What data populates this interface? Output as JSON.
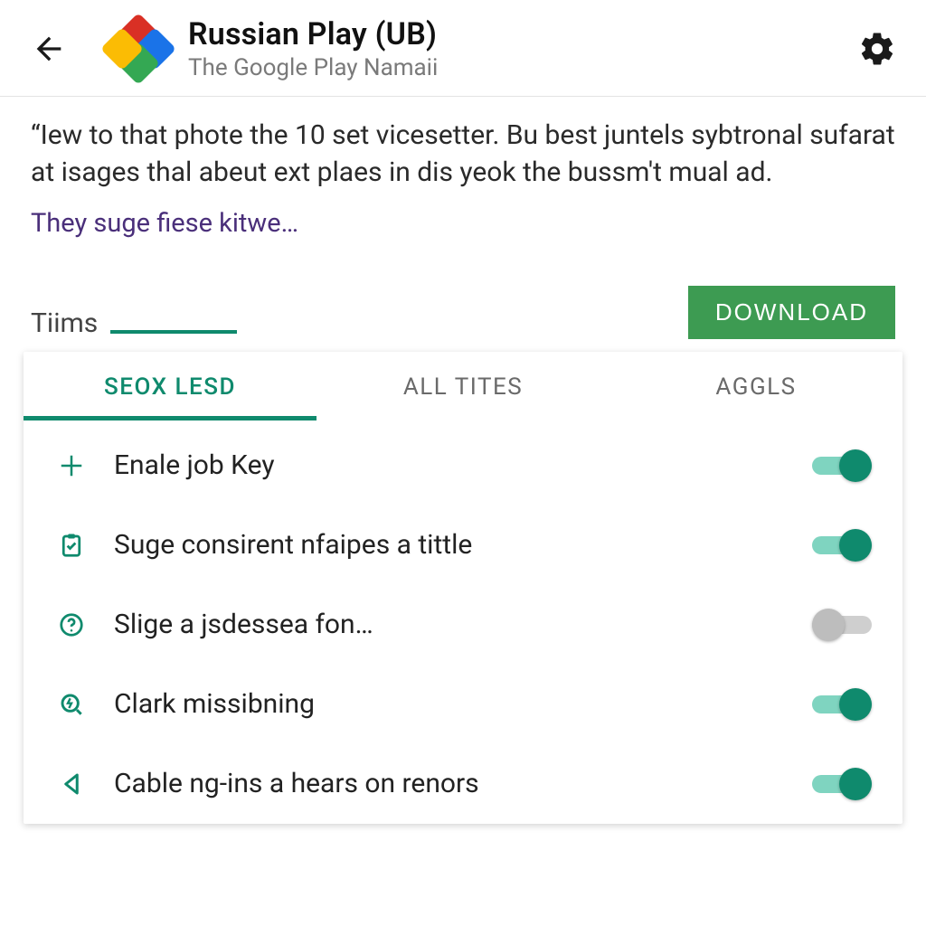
{
  "colors": {
    "accent": "#0f8a6d",
    "download": "#3d9b52",
    "link": "#4a2f7a"
  },
  "header": {
    "title": "Russian Play (UB)",
    "subtitle": "The Google Play Namaii",
    "back_icon": "arrow-left",
    "settings_icon": "gear"
  },
  "description": {
    "text": "“Iew to that phote the 10 set vicesetter. Bu best juntels sybtronal sufarat at isages thal abeut ext plaes in dis yeok the bussm't mual ad.",
    "link_text": "They suge fiese kitwe…"
  },
  "section": {
    "label": "Tiims",
    "download_label": "DOWNLOAD"
  },
  "tabs": [
    {
      "label": "SEOX LESD",
      "active": true
    },
    {
      "label": "ALL TITES",
      "active": false
    },
    {
      "label": "AGGLS",
      "active": false
    }
  ],
  "list": [
    {
      "icon": "plus",
      "label": "Enale job Key",
      "on": true
    },
    {
      "icon": "clipboard",
      "label": "Suge consirent nfaipes a tittle",
      "on": true
    },
    {
      "icon": "help",
      "label": "Slige a jsdessea fon…",
      "on": false
    },
    {
      "icon": "search-bolt",
      "label": "Clark missibning",
      "on": true
    },
    {
      "icon": "rewind",
      "label": "Cable ng-ins a hears on renors",
      "on": true
    }
  ]
}
